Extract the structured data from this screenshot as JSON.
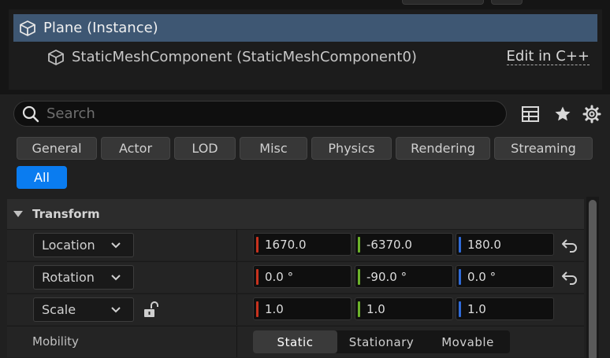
{
  "colors": {
    "selection": "#3e5773",
    "accent": "#0a7cf0",
    "axis_x": "#c8321e",
    "axis_y": "#6cb22a",
    "axis_z": "#2f6bd8"
  },
  "tree": {
    "selected_label": "Plane (Instance)",
    "child_label": "StaticMeshComponent (StaticMeshComponent0)",
    "edit_link": "Edit in C++",
    "icon": "cube-icon"
  },
  "search": {
    "placeholder": "Search",
    "value": ""
  },
  "toolbar_icons": [
    "table-view-icon",
    "favorites-star-icon",
    "settings-gear-icon"
  ],
  "filters": [
    {
      "label": "General"
    },
    {
      "label": "Actor"
    },
    {
      "label": "LOD"
    },
    {
      "label": "Misc"
    },
    {
      "label": "Physics"
    },
    {
      "label": "Rendering"
    },
    {
      "label": "Streaming"
    },
    {
      "label": "All",
      "active": true
    }
  ],
  "transform": {
    "section_title": "Transform",
    "location": {
      "label": "Location",
      "x": "1670.0",
      "y": "-6370.0",
      "z": "180.0"
    },
    "rotation": {
      "label": "Rotation",
      "x": "0.0 °",
      "y": "-90.0 °",
      "z": "0.0 °"
    },
    "scale": {
      "label": "Scale",
      "x": "1.0",
      "y": "1.0",
      "z": "1.0"
    },
    "mobility": {
      "label": "Mobility",
      "options": [
        "Static",
        "Stationary",
        "Movable"
      ],
      "selected": "Static"
    }
  }
}
